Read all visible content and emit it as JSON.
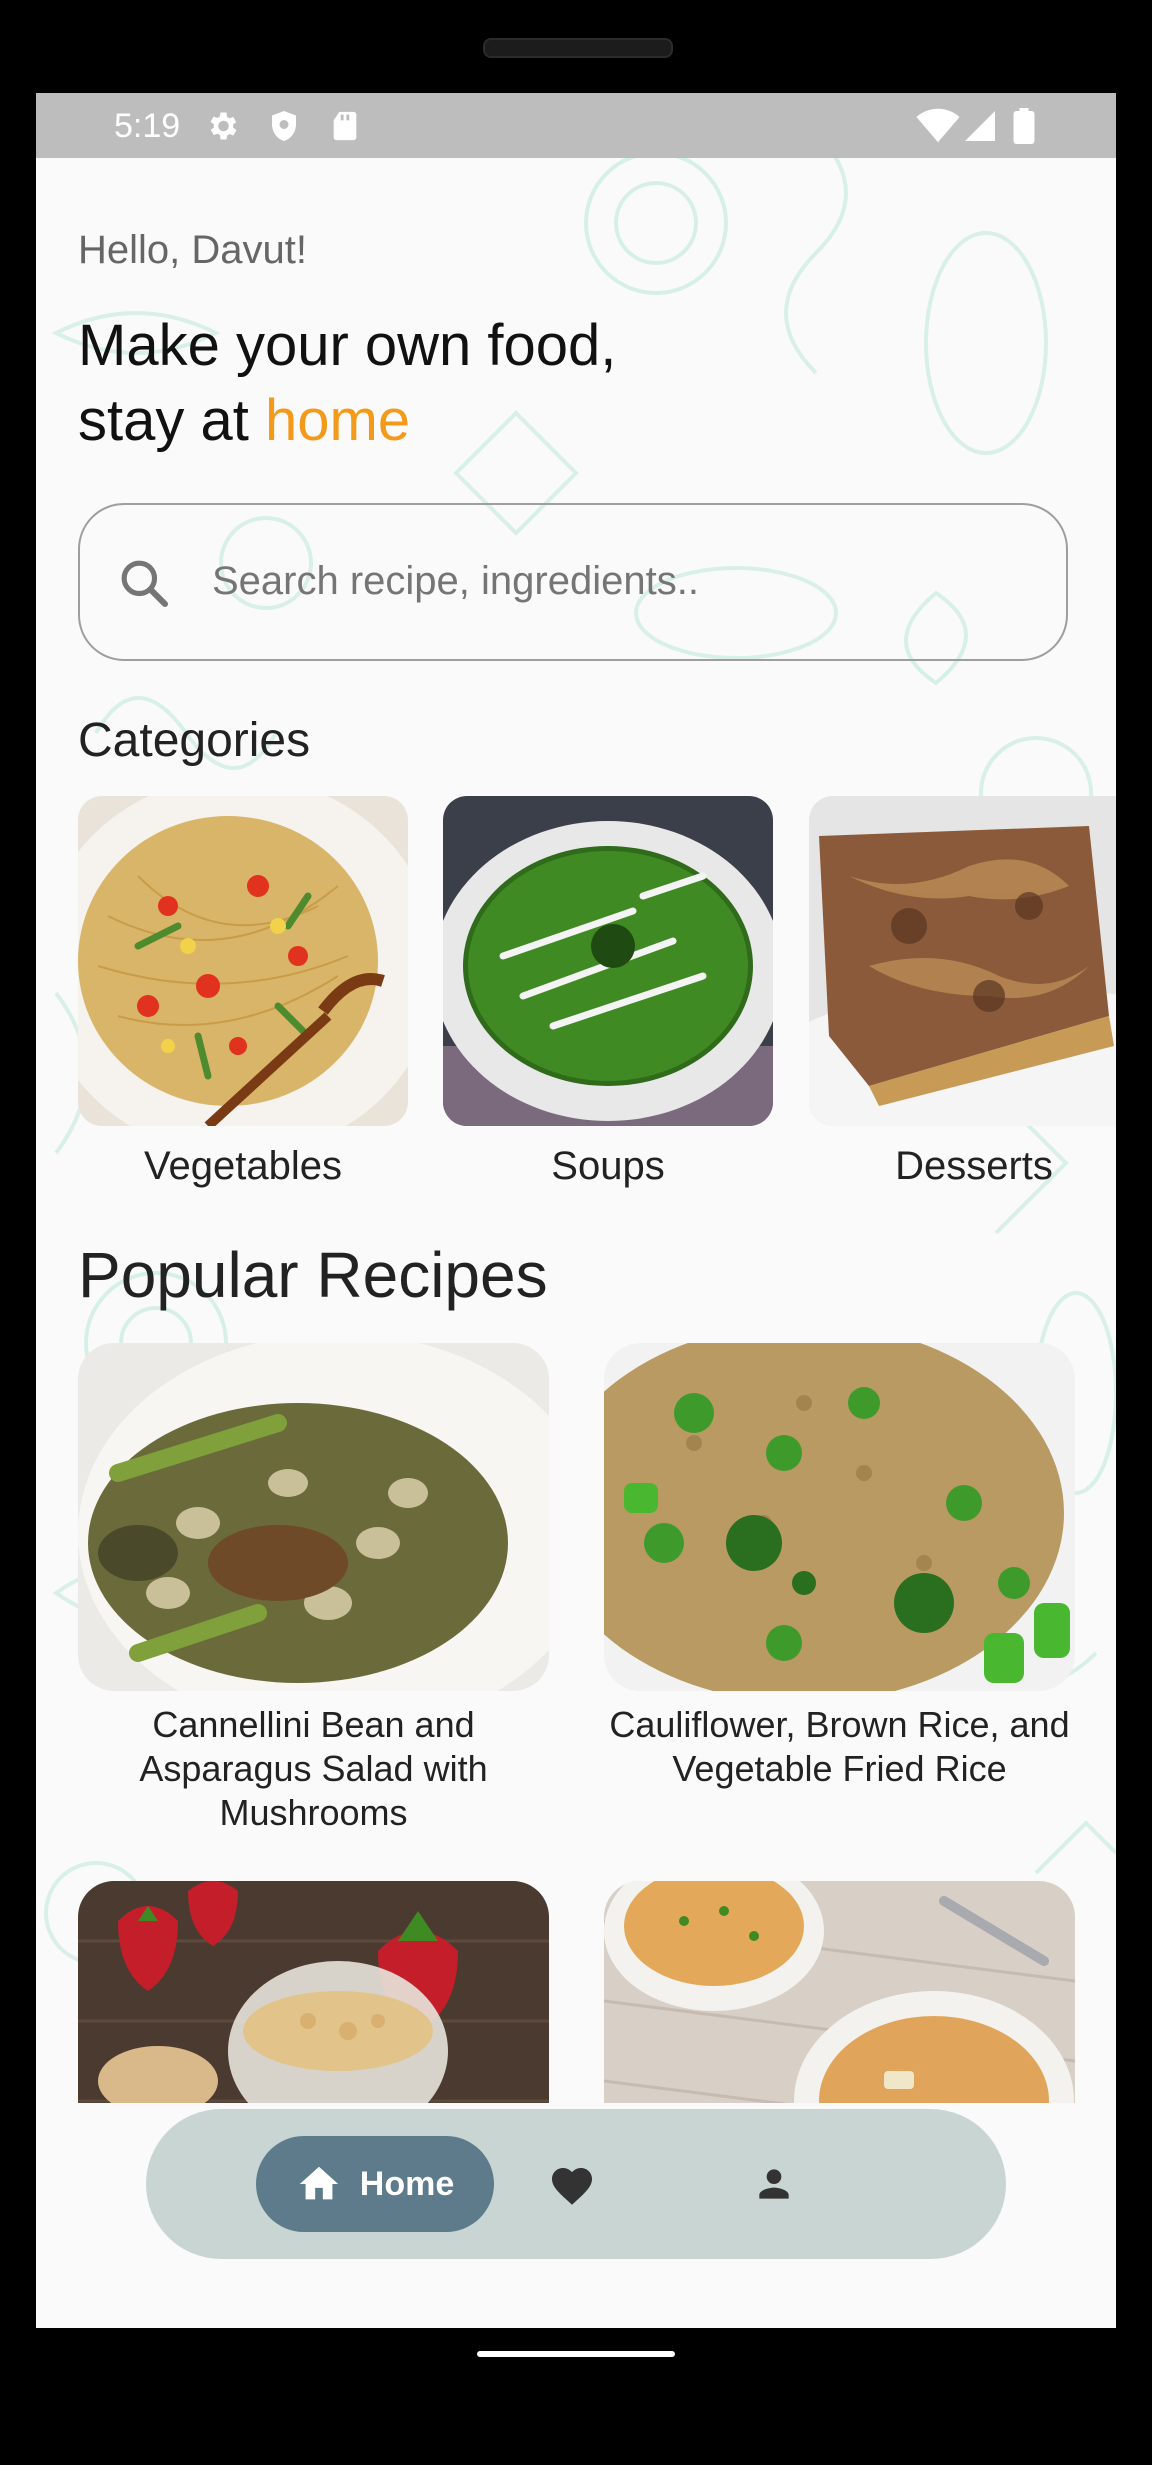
{
  "status_bar": {
    "time": "5:19"
  },
  "header": {
    "greeting": "Hello, Davut!",
    "headline_line1": "Make your own food,",
    "headline_line2_prefix": "stay at ",
    "headline_accent": "home"
  },
  "search": {
    "placeholder": "Search recipe, ingredients.."
  },
  "categories": {
    "title": "Categories",
    "items": [
      {
        "label": "Vegetables"
      },
      {
        "label": "Soups"
      },
      {
        "label": "Desserts"
      }
    ]
  },
  "popular": {
    "title": "Popular Recipes",
    "items": [
      {
        "title": "Cannellini Bean and Asparagus Salad with Mushrooms"
      },
      {
        "title": "Cauliflower, Brown Rice, and Vegetable Fried Rice"
      },
      {
        "title": ""
      },
      {
        "title": ""
      }
    ]
  },
  "nav": {
    "home_label": "Home"
  },
  "colors": {
    "accent": "#f39a1a",
    "nav_active": "#5d7b8b",
    "nav_bg": "#c8d5d2"
  }
}
